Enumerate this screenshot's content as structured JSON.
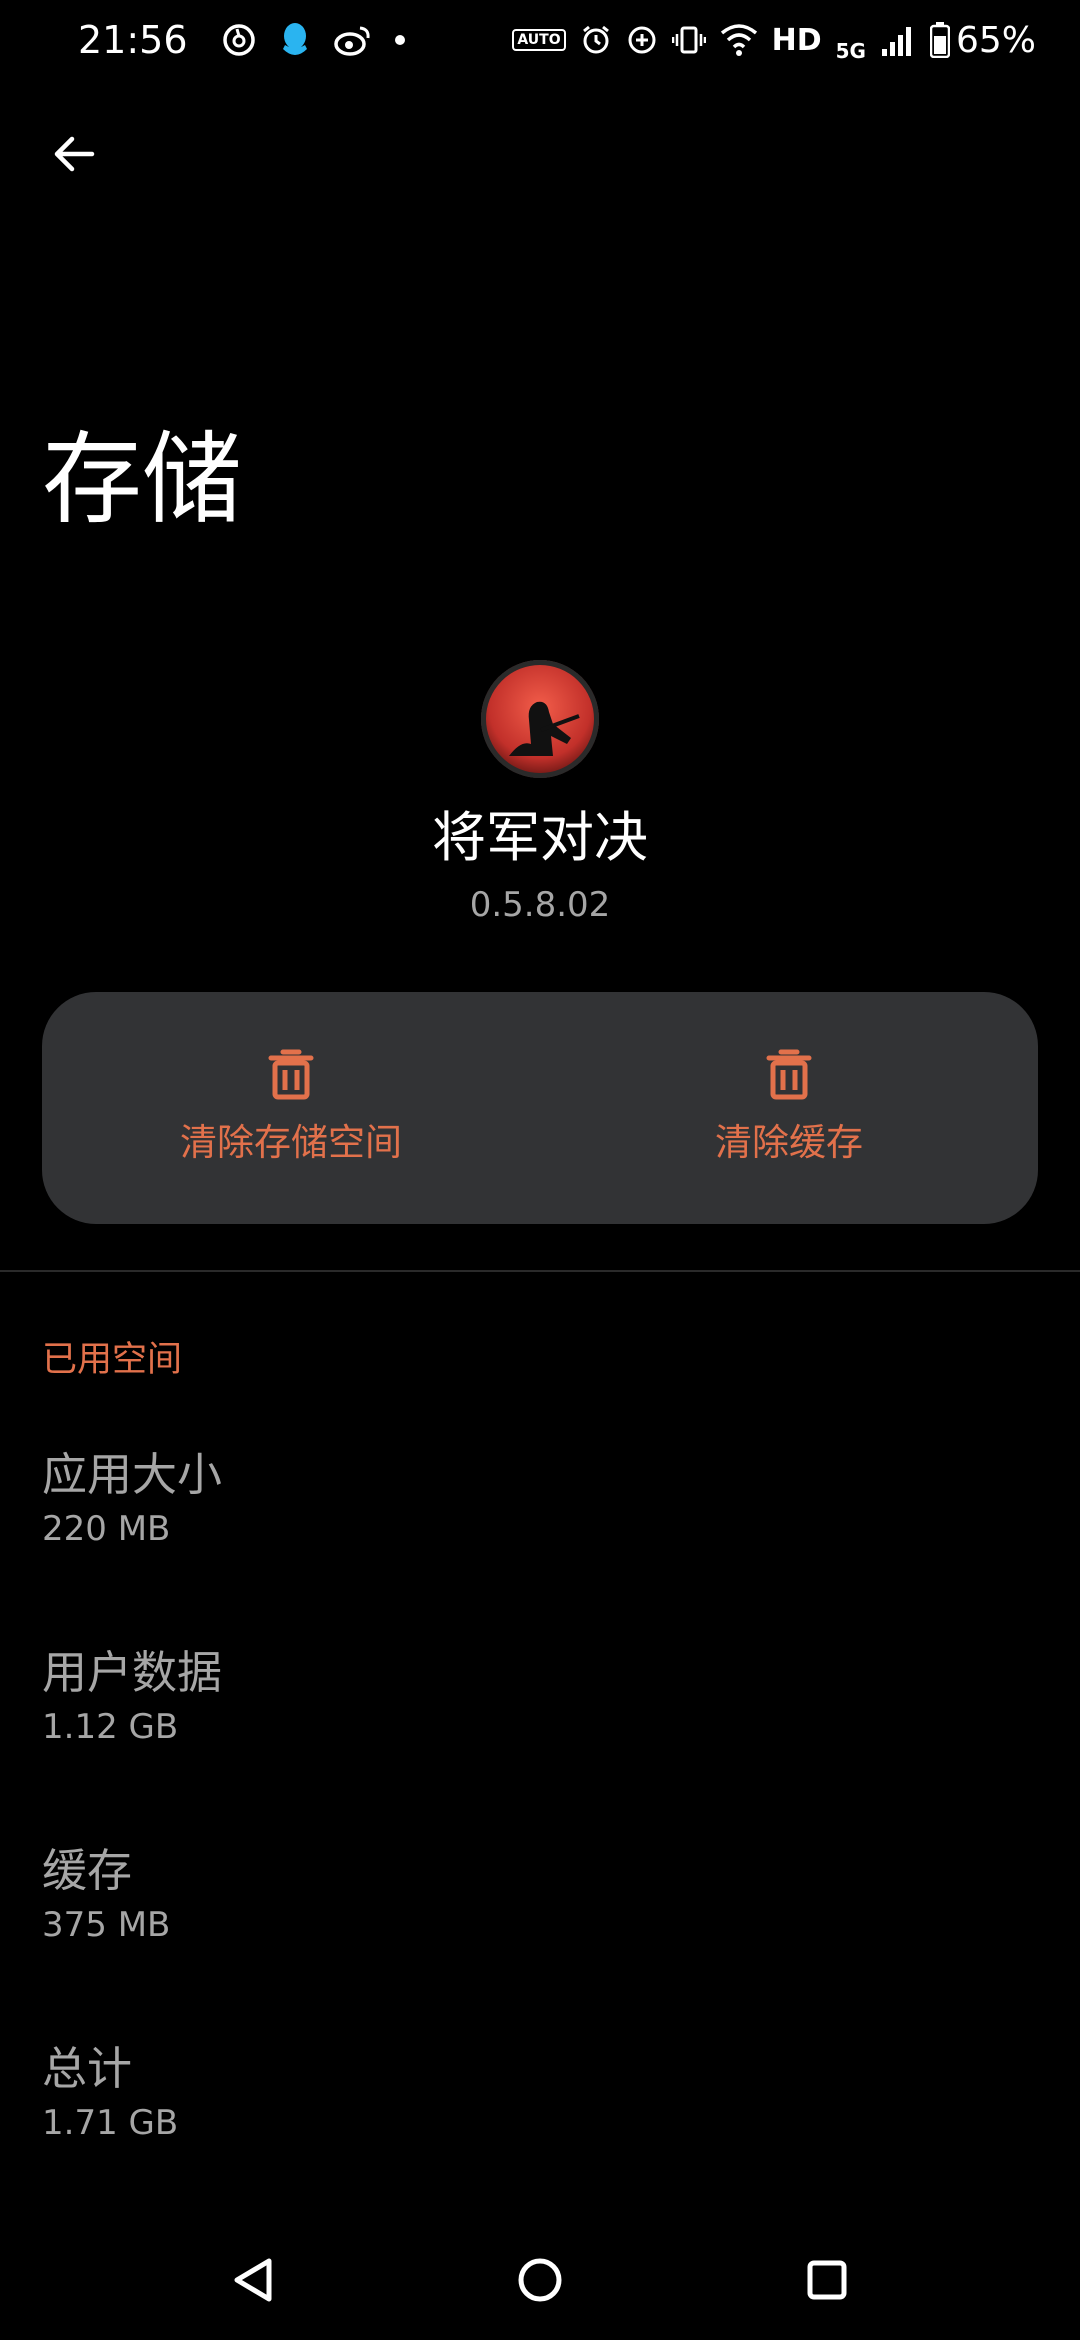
{
  "status_bar": {
    "time": "21:56",
    "auto_badge": "AUTO",
    "hd": "HD",
    "network": "5G",
    "battery": "65%",
    "icons": [
      "netease-music-icon",
      "qq-icon",
      "weibo-icon",
      "dot-icon",
      "auto-refresh-icon",
      "alarm-icon",
      "data-saver-icon",
      "vibrate-icon",
      "wifi-icon",
      "signal-icon",
      "battery-icon"
    ]
  },
  "page": {
    "title": "存储"
  },
  "app": {
    "name": "将军对决",
    "version": "0.5.8.02"
  },
  "actions": {
    "clear_storage": "清除存储空间",
    "clear_cache": "清除缓存"
  },
  "section": {
    "header": "已用空间",
    "items": [
      {
        "title": "应用大小",
        "value": "220 MB"
      },
      {
        "title": "用户数据",
        "value": "1.12 GB"
      },
      {
        "title": "缓存",
        "value": "375 MB"
      },
      {
        "title": "总计",
        "value": "1.71 GB"
      }
    ]
  },
  "colors": {
    "accent": "#e2714b",
    "background": "#000000",
    "card": "#323335",
    "secondary_text": "#a6a6a6"
  }
}
